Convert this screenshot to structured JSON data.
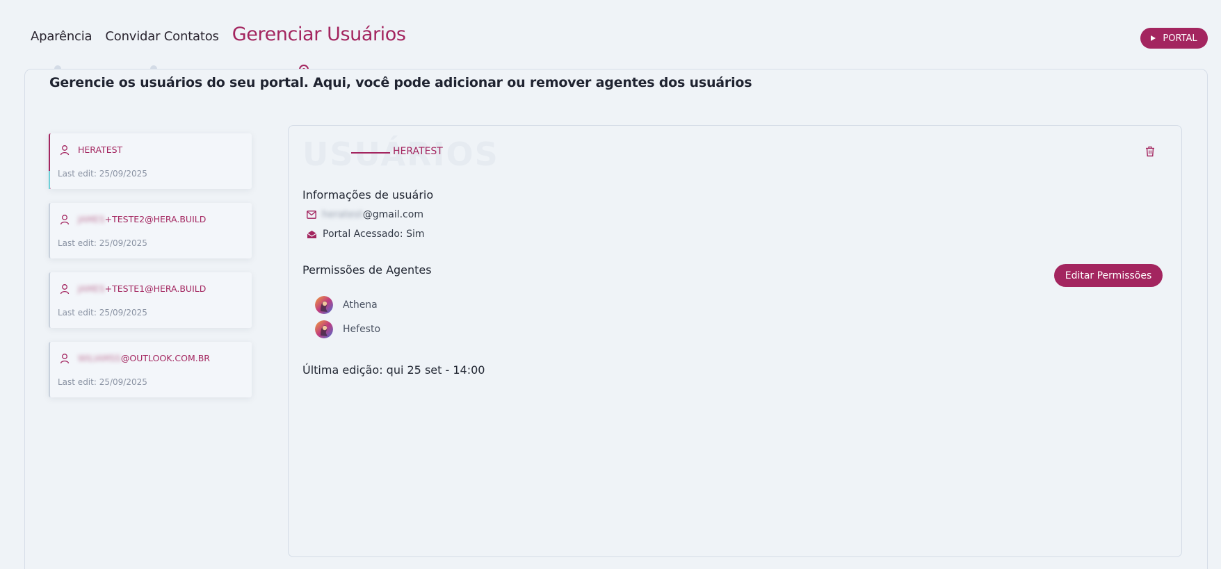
{
  "nav": {
    "tabs": [
      {
        "label": "Aparência"
      },
      {
        "label": "Convidar Contatos"
      },
      {
        "label": "Gerenciar Usuários"
      }
    ],
    "portal_button": "PORTAL"
  },
  "page": {
    "subtitle": "Gerencie os usuários do seu portal. Aqui, você pode adicionar ou remover agentes dos usuários"
  },
  "users": [
    {
      "name_hidden": "",
      "name_visible": "HERATEST",
      "last_edit": "Last edit: 25/09/2025"
    },
    {
      "name_hidden": "JAMES",
      "name_visible": "+TESTE2@HERA.BUILD",
      "last_edit": "Last edit: 25/09/2025"
    },
    {
      "name_hidden": "JAMES",
      "name_visible": "+TESTE1@HERA.BUILD",
      "last_edit": "Last edit: 25/09/2025"
    },
    {
      "name_hidden": "WILIAMSS",
      "name_visible": "@OUTLOOK.COM.BR",
      "last_edit": "Last edit: 25/09/2025"
    }
  ],
  "detail": {
    "watermark": "USUÁRIOS",
    "selected_user": "HERATEST",
    "info_title": "Informações de usuário",
    "email_hidden": "heratest",
    "email_visible": "@gmail.com",
    "portal_access": "Portal Acessado: Sim",
    "permissions_title": "Permissões de Agentes",
    "edit_permissions_button": "Editar Permissões",
    "agents": [
      {
        "name": "Athena"
      },
      {
        "name": "Hefesto"
      }
    ],
    "last_edit": "Última edição: qui 25 set - 14:00"
  },
  "colors": {
    "brand": "#a3255f",
    "background": "#eff3f7"
  },
  "icons": {
    "user": "user-icon",
    "email": "mail-icon",
    "portal": "mail-open-icon",
    "delete": "trash-icon",
    "portal_button": "play-icon"
  }
}
